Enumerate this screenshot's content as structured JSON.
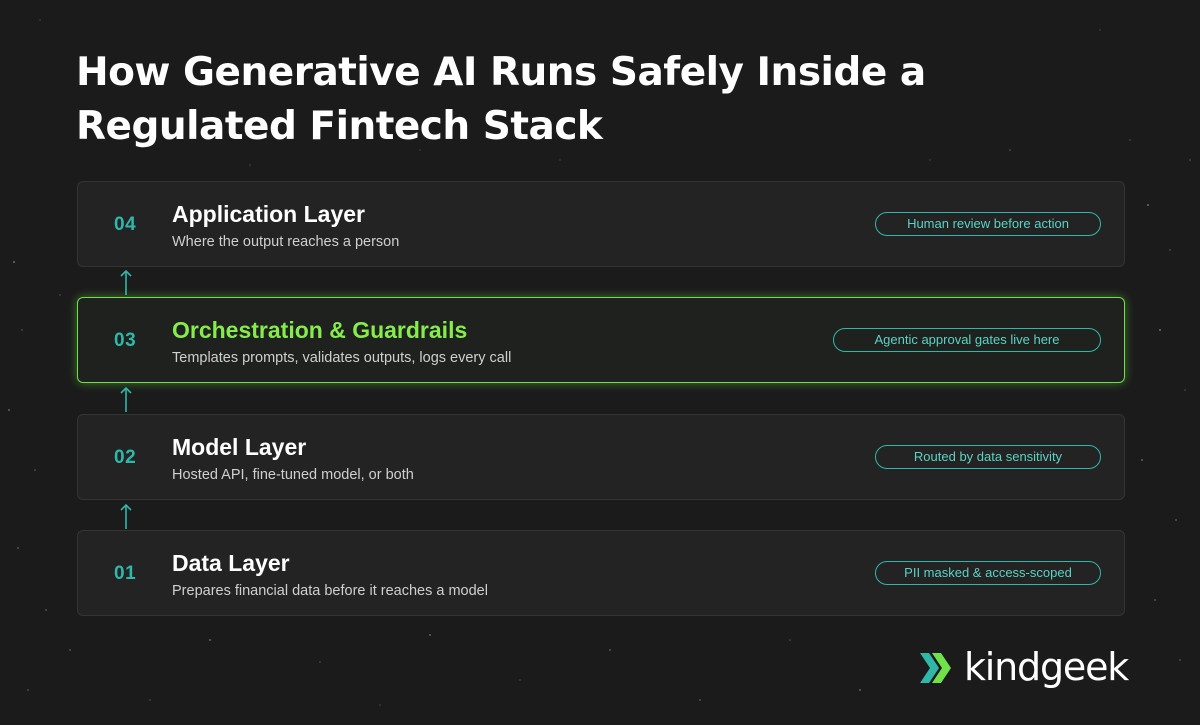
{
  "title": "How Generative AI Runs Safely Inside a Regulated Fintech Stack",
  "layers": [
    {
      "number": "04",
      "name": "Application Layer",
      "description": "Where the output reaches a person",
      "badge": "Human review before action"
    },
    {
      "number": "03",
      "name": "Orchestration & Guardrails",
      "description": "Templates prompts, validates outputs, logs every call",
      "badge": "Agentic approval gates live here",
      "highlighted": true
    },
    {
      "number": "02",
      "name": "Model Layer",
      "description": "Hosted API, fine-tuned model, or both",
      "badge": "Routed by data sensitivity"
    },
    {
      "number": "01",
      "name": "Data Layer",
      "description": "Prepares financial data before it reaches a model",
      "badge": "PII masked & access-scoped"
    }
  ],
  "connector_icon": "arrow-up-icon",
  "logo": {
    "icon": "double-chevron-right-icon",
    "wordmark": "kindgeek"
  },
  "colors": {
    "background": "#1b1b1b",
    "card": "#232323",
    "accent_teal": "#2fb8a9",
    "accent_green": "#6fe14a"
  }
}
